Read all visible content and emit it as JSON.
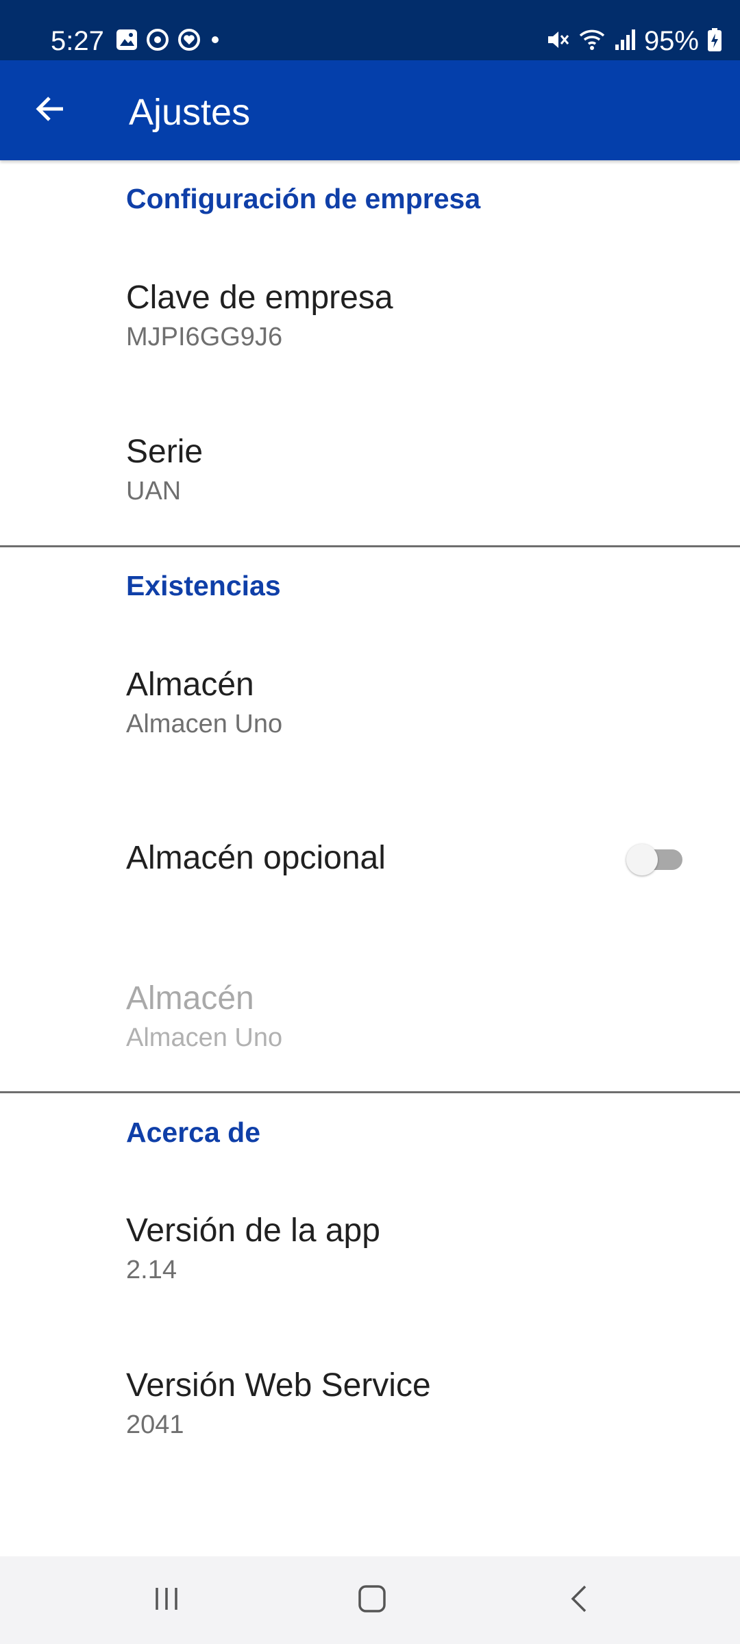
{
  "status_bar": {
    "time": "5:27",
    "battery": "95%",
    "background": "#022d6b"
  },
  "app_bar": {
    "title": "Ajustes",
    "background": "#043fab",
    "back_icon": "arrow-back-icon"
  },
  "sections": {
    "company": {
      "header": "Configuración de empresa",
      "company_key": {
        "title": "Clave de empresa",
        "summary": "MJPI6GG9J6"
      },
      "series": {
        "title": "Serie",
        "summary": "UAN"
      }
    },
    "stock": {
      "header": "Existencias",
      "warehouse": {
        "title": "Almacén",
        "summary": "Almacen Uno"
      },
      "optional_warehouse": {
        "title": "Almacén opcional",
        "enabled": false
      },
      "warehouse_secondary": {
        "title": "Almacén",
        "summary": "Almacen Uno",
        "disabled": true
      }
    },
    "about": {
      "header": "Acerca de",
      "app_version": {
        "title": "Versión de la app",
        "summary": "2.14"
      },
      "webservice_version": {
        "title": "Versión Web Service",
        "summary": "2041"
      }
    }
  },
  "colors": {
    "accent": "#0f3fa8",
    "divider": "#6e6e6e"
  },
  "nav_bar": {
    "icons": [
      "recent-apps-icon",
      "home-icon",
      "back-nav-icon"
    ]
  }
}
